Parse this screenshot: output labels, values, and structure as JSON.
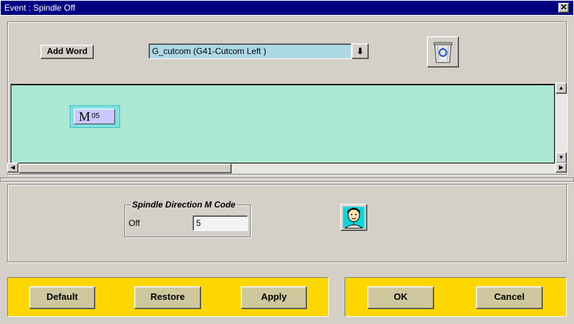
{
  "window": {
    "title": "Event : Spindle Off",
    "close_glyph": "✕"
  },
  "toolbar": {
    "add_word_label": "Add Word",
    "word_select_value": "G_cutcom (G41-Cutcom Left )",
    "dropdown_glyph": "⬇"
  },
  "canvas": {
    "word_chip": {
      "letter": "M",
      "value": "05"
    }
  },
  "spindle_group": {
    "legend": "Spindle Direction M Code",
    "field_label": "Off",
    "field_value": "5"
  },
  "buttons": {
    "default": "Default",
    "restore": "Restore",
    "apply": "Apply",
    "ok": "OK",
    "cancel": "Cancel"
  },
  "colors": {
    "canvas_bg": "#ace8d4",
    "button_bar": "#ffd700",
    "titlebar": "#000080",
    "select_field": "#add8e6"
  },
  "icons": {
    "trash": "recycle-bin-icon",
    "person": "user-avatar-icon"
  }
}
